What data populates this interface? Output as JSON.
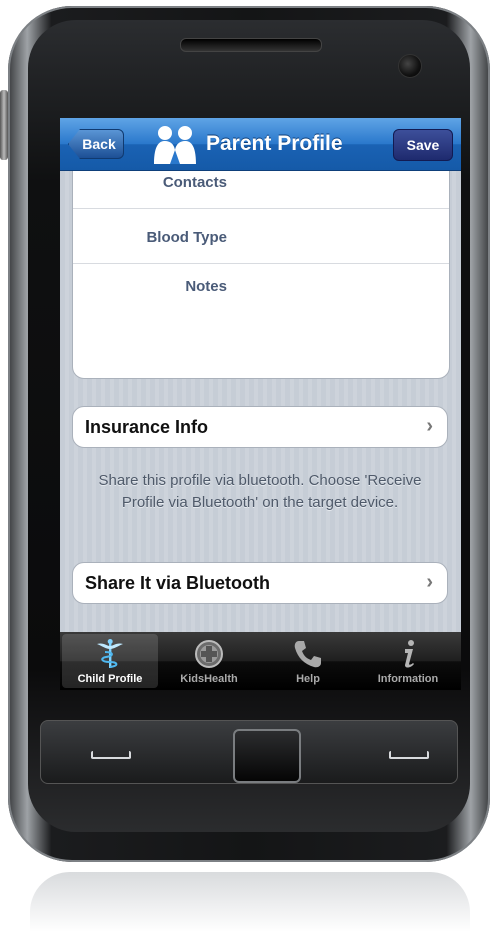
{
  "navbar": {
    "back_label": "Back",
    "title": "Parent Profile",
    "save_label": "Save",
    "logo_icon": "family-logo-icon",
    "color": "#2a78cc"
  },
  "profile_fields": {
    "contacts_label": "Contacts",
    "blood_type_label": "Blood Type",
    "notes_label": "Notes"
  },
  "insurance": {
    "label": "Insurance Info",
    "chevron": "›"
  },
  "bluetooth_note": "Share this profile via bluetooth. Choose 'Receive Profile via Bluetooth' on the target device.",
  "share": {
    "label": "Share It via Bluetooth",
    "chevron": "›"
  },
  "tabbar": {
    "tabs": [
      {
        "label": "Child Profile",
        "icon": "caduceus-icon"
      },
      {
        "label": "KidsHealth",
        "icon": "cross-circle-icon"
      },
      {
        "label": "Help",
        "icon": "phone-icon"
      },
      {
        "label": "Information",
        "icon": "info-icon"
      }
    ],
    "active_index": 0
  }
}
